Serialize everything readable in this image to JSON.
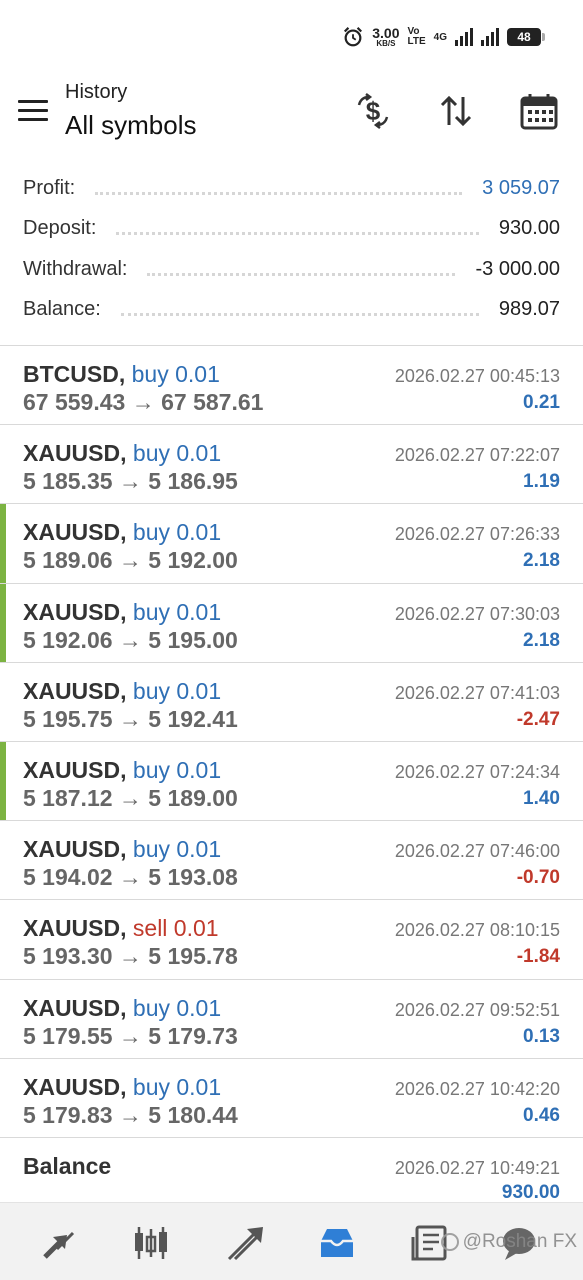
{
  "status_bar": {
    "speed_value": "3.00",
    "speed_unit": "KB/S",
    "volte_top": "Vo",
    "volte_bottom": "LTE",
    "network": "4G",
    "battery": "48"
  },
  "header": {
    "subtitle": "History",
    "title": "All symbols"
  },
  "summary": [
    {
      "label": "Profit:",
      "value": "3 059.07",
      "highlight": true
    },
    {
      "label": "Deposit:",
      "value": "930.00",
      "highlight": false
    },
    {
      "label": "Withdrawal:",
      "value": "-3 000.00",
      "highlight": false
    },
    {
      "label": "Balance:",
      "value": "989.07",
      "highlight": false
    }
  ],
  "deals": [
    {
      "symbol": "BTCUSD,",
      "side": "buy 0.01",
      "direction": "buy",
      "prices": "67 559.43 → 67 587.61",
      "time": "2026.02.27 00:45:13",
      "profit": "0.21",
      "positive": true,
      "marked": false
    },
    {
      "symbol": "XAUUSD,",
      "side": "buy 0.01",
      "direction": "buy",
      "prices": "5 185.35 → 5 186.95",
      "time": "2026.02.27 07:22:07",
      "profit": "1.19",
      "positive": true,
      "marked": false
    },
    {
      "symbol": "XAUUSD,",
      "side": "buy 0.01",
      "direction": "buy",
      "prices": "5 189.06 → 5 192.00",
      "time": "2026.02.27 07:26:33",
      "profit": "2.18",
      "positive": true,
      "marked": true
    },
    {
      "symbol": "XAUUSD,",
      "side": "buy 0.01",
      "direction": "buy",
      "prices": "5 192.06 → 5 195.00",
      "time": "2026.02.27 07:30:03",
      "profit": "2.18",
      "positive": true,
      "marked": true
    },
    {
      "symbol": "XAUUSD,",
      "side": "buy 0.01",
      "direction": "buy",
      "prices": "5 195.75 → 5 192.41",
      "time": "2026.02.27 07:41:03",
      "profit": "-2.47",
      "positive": false,
      "marked": false
    },
    {
      "symbol": "XAUUSD,",
      "side": "buy 0.01",
      "direction": "buy",
      "prices": "5 187.12 → 5 189.00",
      "time": "2026.02.27 07:24:34",
      "profit": "1.40",
      "positive": true,
      "marked": true
    },
    {
      "symbol": "XAUUSD,",
      "side": "buy 0.01",
      "direction": "buy",
      "prices": "5 194.02 → 5 193.08",
      "time": "2026.02.27 07:46:00",
      "profit": "-0.70",
      "positive": false,
      "marked": false
    },
    {
      "symbol": "XAUUSD,",
      "side": "sell 0.01",
      "direction": "sell",
      "prices": "5 193.30 → 5 195.78",
      "time": "2026.02.27 08:10:15",
      "profit": "-1.84",
      "positive": false,
      "marked": false
    },
    {
      "symbol": "XAUUSD,",
      "side": "buy 0.01",
      "direction": "buy",
      "prices": "5 179.55 → 5 179.73",
      "time": "2026.02.27 09:52:51",
      "profit": "0.13",
      "positive": true,
      "marked": false
    },
    {
      "symbol": "XAUUSD,",
      "side": "buy 0.01",
      "direction": "buy",
      "prices": "5 179.83 → 5 180.44",
      "time": "2026.02.27 10:42:20",
      "profit": "0.46",
      "positive": true,
      "marked": false
    }
  ],
  "balance_entry": {
    "label": "Balance",
    "time": "2026.02.27 10:49:21",
    "amount": "930.00"
  },
  "bottom_nav": {
    "items": [
      {
        "icon": "quotes-arrows-icon",
        "active": false
      },
      {
        "icon": "chart-candles-icon",
        "active": false
      },
      {
        "icon": "trade-icon",
        "active": false
      },
      {
        "icon": "history-inbox-icon",
        "active": true
      },
      {
        "icon": "news-icon",
        "active": false
      },
      {
        "icon": "messages-icon",
        "active": false
      }
    ],
    "watermark": "@Roshan FX"
  },
  "colors": {
    "accent_blue": "#2f6fb5",
    "loss_red": "#c0392b",
    "marker_green": "#7cb342"
  }
}
